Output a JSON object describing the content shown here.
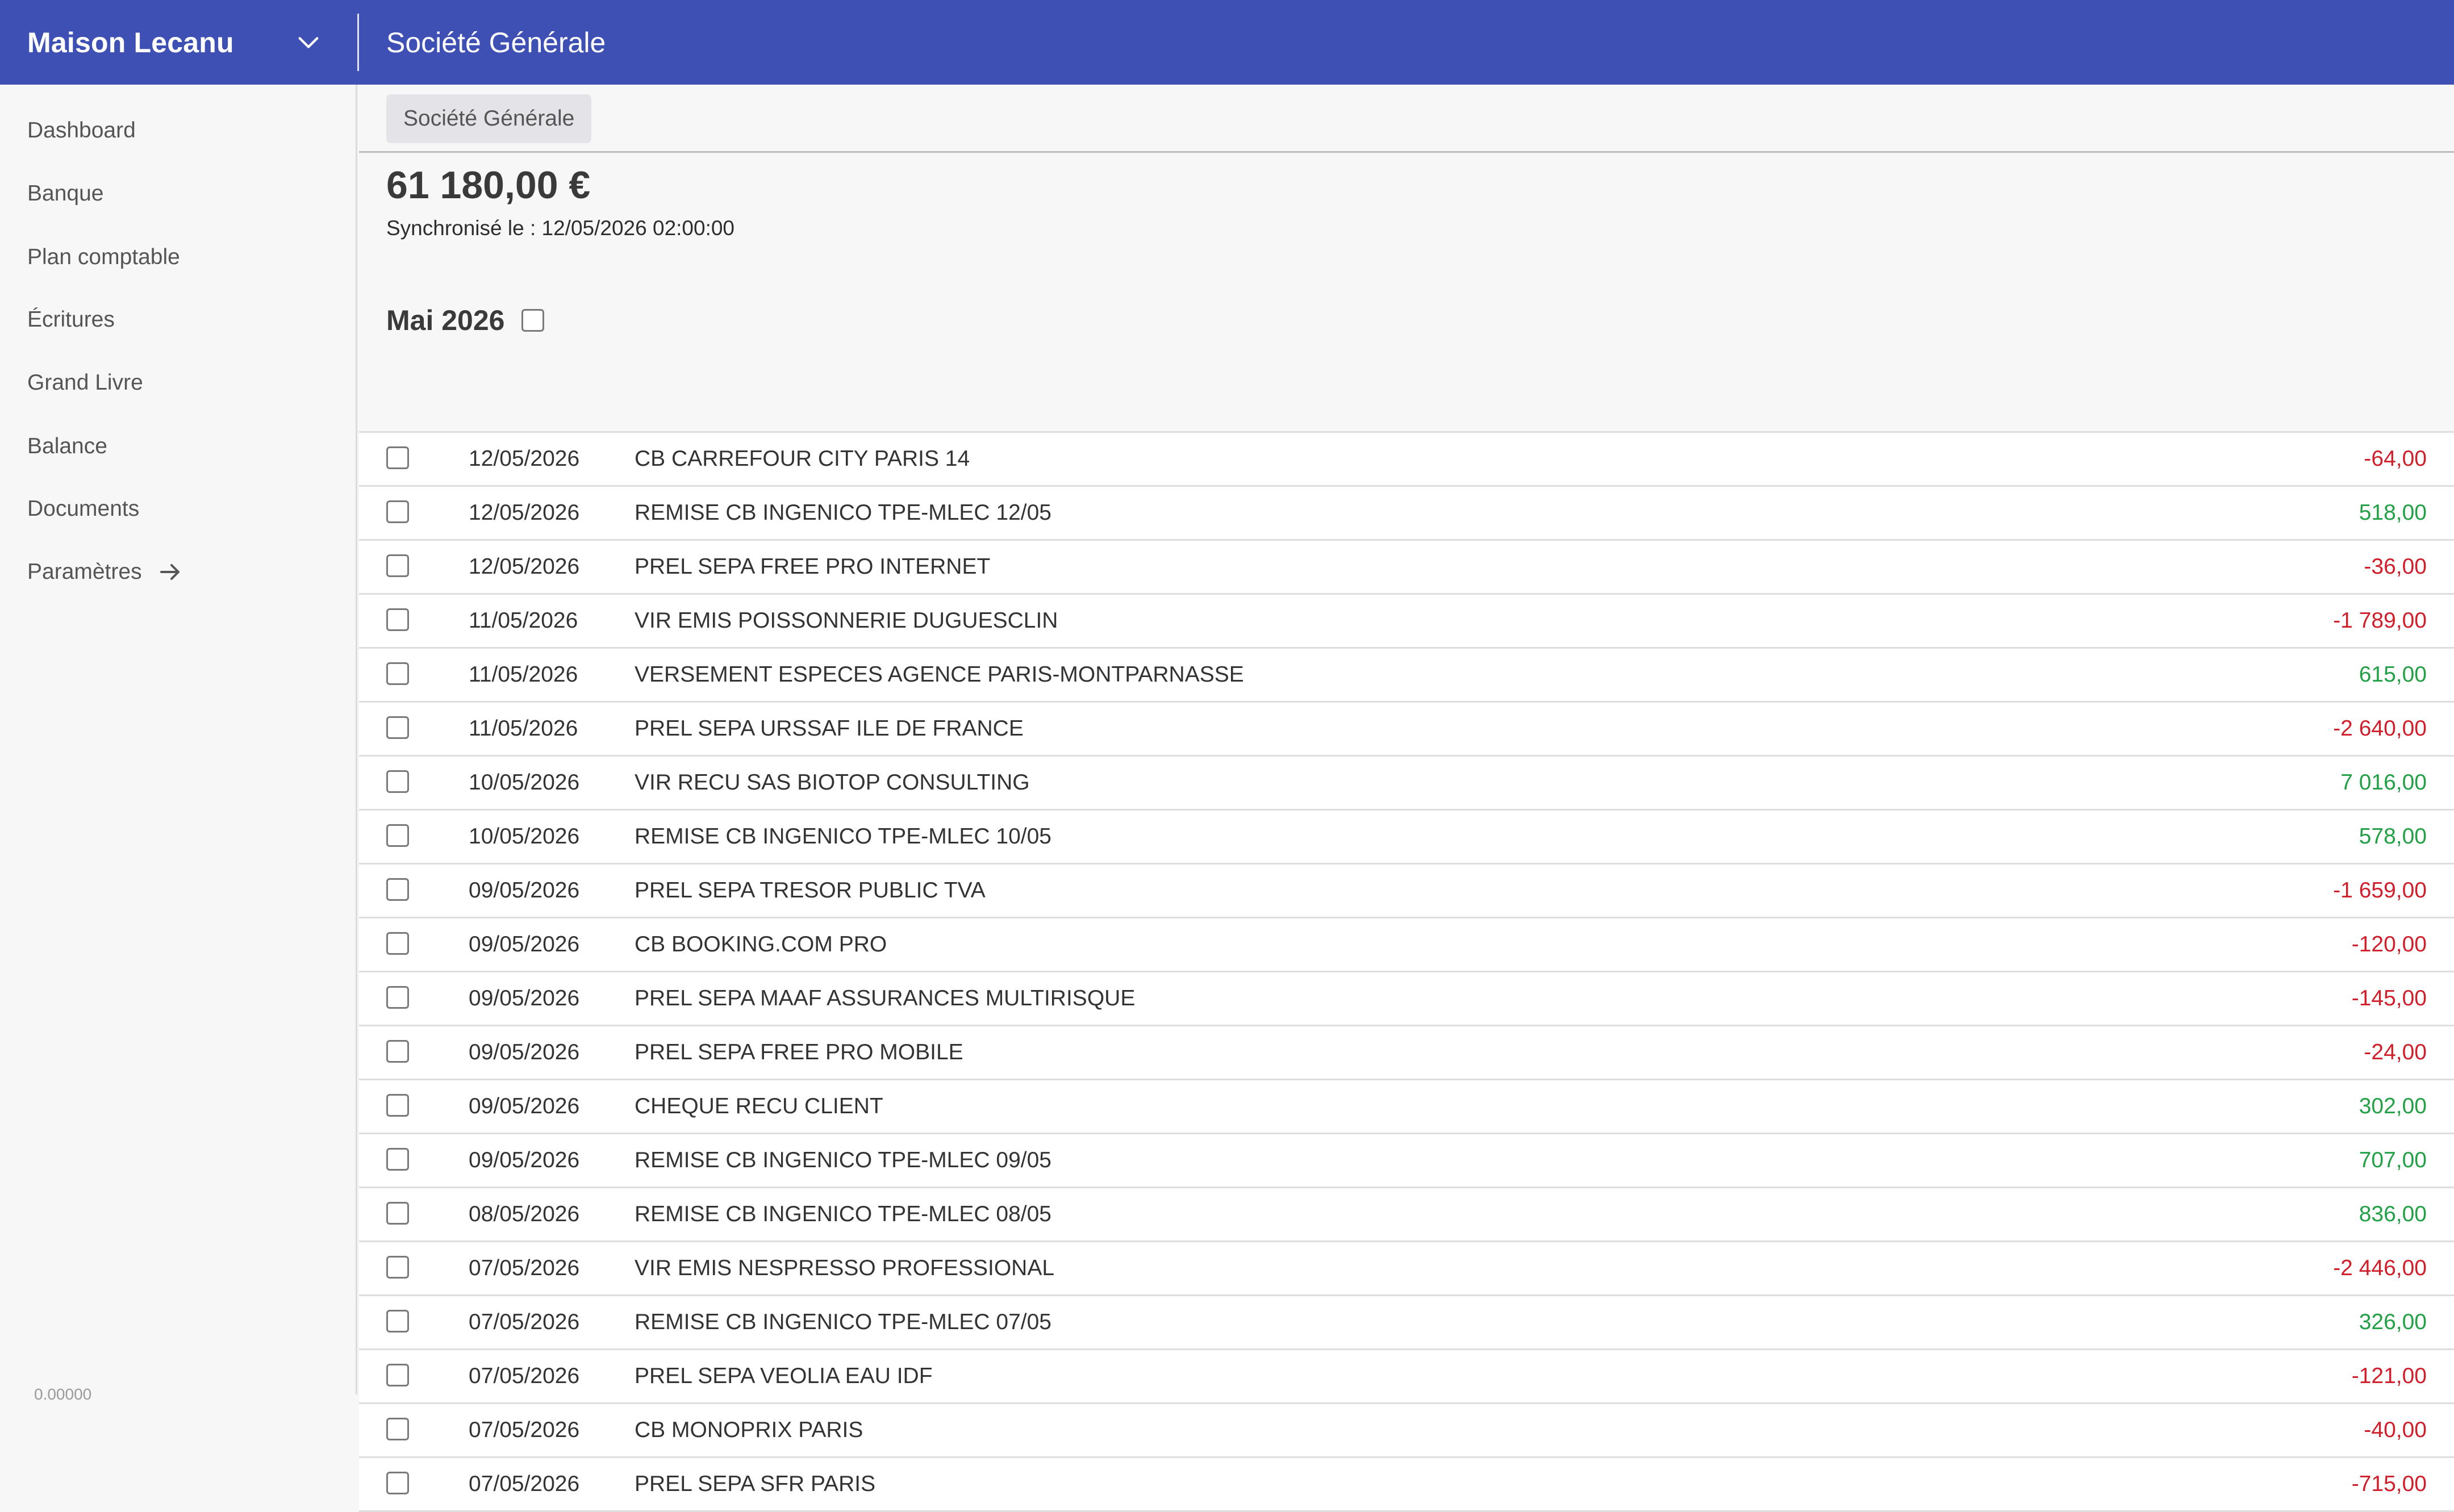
{
  "header": {
    "company_name": "Maison Lecanu",
    "bank_title": "Société Générale"
  },
  "sidebar": {
    "items": [
      {
        "label": "Dashboard"
      },
      {
        "label": "Banque"
      },
      {
        "label": "Plan comptable"
      },
      {
        "label": "Écritures"
      },
      {
        "label": "Grand Livre"
      },
      {
        "label": "Balance"
      },
      {
        "label": "Documents"
      },
      {
        "label": "Paramètres"
      }
    ],
    "version": "0.00000"
  },
  "main": {
    "tab_label": "Société Générale",
    "balance": "61 180,00 €",
    "sync_text": "Synchronisé le : 12/05/2026 02:00:00",
    "month_label": "Mai 2026",
    "colors": {
      "debit": "#d01e2a",
      "credit": "#22a045",
      "header": "#3e50b4"
    },
    "transactions": [
      {
        "date": "12/05/2026",
        "label": "CB CARREFOUR CITY PARIS 14",
        "amount": "-64,00",
        "type": "debit"
      },
      {
        "date": "12/05/2026",
        "label": "REMISE CB INGENICO TPE-MLEC 12/05",
        "amount": "518,00",
        "type": "credit"
      },
      {
        "date": "12/05/2026",
        "label": "PREL SEPA FREE PRO INTERNET",
        "amount": "-36,00",
        "type": "debit"
      },
      {
        "date": "11/05/2026",
        "label": "VIR EMIS POISSONNERIE DUGUESCLIN",
        "amount": "-1 789,00",
        "type": "debit"
      },
      {
        "date": "11/05/2026",
        "label": "VERSEMENT ESPECES AGENCE PARIS-MONTPARNASSE",
        "amount": "615,00",
        "type": "credit"
      },
      {
        "date": "11/05/2026",
        "label": "PREL SEPA URSSAF ILE DE FRANCE",
        "amount": "-2 640,00",
        "type": "debit"
      },
      {
        "date": "10/05/2026",
        "label": "VIR RECU SAS BIOTOP CONSULTING",
        "amount": "7 016,00",
        "type": "credit"
      },
      {
        "date": "10/05/2026",
        "label": "REMISE CB INGENICO TPE-MLEC 10/05",
        "amount": "578,00",
        "type": "credit"
      },
      {
        "date": "09/05/2026",
        "label": "PREL SEPA TRESOR PUBLIC TVA",
        "amount": "-1 659,00",
        "type": "debit"
      },
      {
        "date": "09/05/2026",
        "label": "CB BOOKING.COM PRO",
        "amount": "-120,00",
        "type": "debit"
      },
      {
        "date": "09/05/2026",
        "label": "PREL SEPA MAAF ASSURANCES MULTIRISQUE",
        "amount": "-145,00",
        "type": "debit"
      },
      {
        "date": "09/05/2026",
        "label": "PREL SEPA FREE PRO MOBILE",
        "amount": "-24,00",
        "type": "debit"
      },
      {
        "date": "09/05/2026",
        "label": "CHEQUE RECU CLIENT",
        "amount": "302,00",
        "type": "credit"
      },
      {
        "date": "09/05/2026",
        "label": "REMISE CB INGENICO TPE-MLEC 09/05",
        "amount": "707,00",
        "type": "credit"
      },
      {
        "date": "08/05/2026",
        "label": "REMISE CB INGENICO TPE-MLEC 08/05",
        "amount": "836,00",
        "type": "credit"
      },
      {
        "date": "07/05/2026",
        "label": "VIR EMIS NESPRESSO PROFESSIONAL",
        "amount": "-2 446,00",
        "type": "debit"
      },
      {
        "date": "07/05/2026",
        "label": "REMISE CB INGENICO TPE-MLEC 07/05",
        "amount": "326,00",
        "type": "credit"
      },
      {
        "date": "07/05/2026",
        "label": "PREL SEPA VEOLIA EAU IDF",
        "amount": "-121,00",
        "type": "debit"
      },
      {
        "date": "07/05/2026",
        "label": "CB MONOPRIX PARIS",
        "amount": "-40,00",
        "type": "debit"
      },
      {
        "date": "07/05/2026",
        "label": "PREL SEPA SFR PARIS",
        "amount": "-715,00",
        "type": "debit"
      }
    ]
  }
}
